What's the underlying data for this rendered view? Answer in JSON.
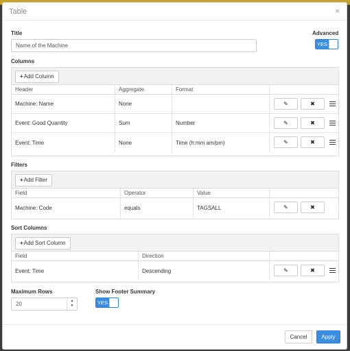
{
  "modal": {
    "title": "Table",
    "close_icon": "×"
  },
  "title_field": {
    "label": "Title",
    "value": "Name of the Machine"
  },
  "advanced": {
    "label": "Advanced",
    "state": "YES"
  },
  "columns": {
    "label": "Columns",
    "add_label": "Add Column",
    "headers": [
      "Header",
      "Aggregate",
      "Format"
    ],
    "rows": [
      {
        "header": "Machine: Name",
        "aggregate": "None",
        "format": ""
      },
      {
        "header": "Event: Good Quantity",
        "aggregate": "Sum",
        "format": "Number"
      },
      {
        "header": "Event: Time",
        "aggregate": "None",
        "format": "Time (h:mm am/pm)"
      }
    ]
  },
  "filters": {
    "label": "Filters",
    "add_label": "Add Filter",
    "headers": [
      "Field",
      "Operator",
      "Value"
    ],
    "rows": [
      {
        "field": "Machine: Code",
        "operator": "equals",
        "value": "TAGSALL"
      }
    ]
  },
  "sort": {
    "label": "Sort Columns",
    "add_label": "Add Sort Column",
    "headers": [
      "Field",
      "Direction"
    ],
    "rows": [
      {
        "field": "Event: Time",
        "direction": "Descending"
      }
    ]
  },
  "max_rows": {
    "label": "Maximum Rows",
    "value": "20"
  },
  "footer_summary": {
    "label": "Show Footer Summary",
    "state": "YES"
  },
  "footer": {
    "cancel": "Cancel",
    "apply": "Apply"
  },
  "icons": {
    "edit": "pencil-icon",
    "delete": "x-icon",
    "drag": "drag-handle-icon"
  },
  "colors": {
    "accent": "#3a8de3"
  }
}
